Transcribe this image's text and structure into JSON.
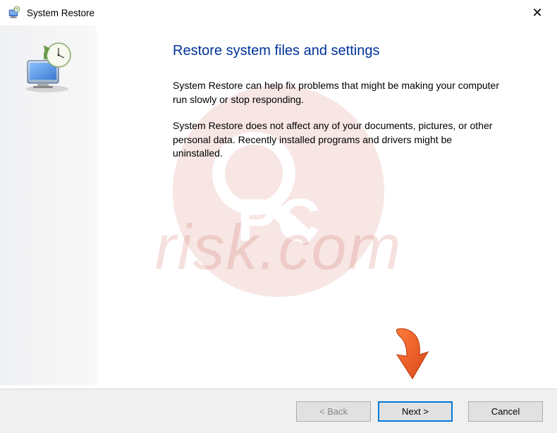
{
  "titlebar": {
    "title": "System Restore"
  },
  "content": {
    "heading": "Restore system files and settings",
    "para1": "System Restore can help fix problems that might be making your computer run slowly or stop responding.",
    "para2": "System Restore does not affect any of your documents, pictures, or other personal data. Recently installed programs and drivers might be uninstalled."
  },
  "buttons": {
    "back": "< Back",
    "next": "Next >",
    "cancel": "Cancel"
  },
  "watermark": {
    "text": "risk.com"
  }
}
